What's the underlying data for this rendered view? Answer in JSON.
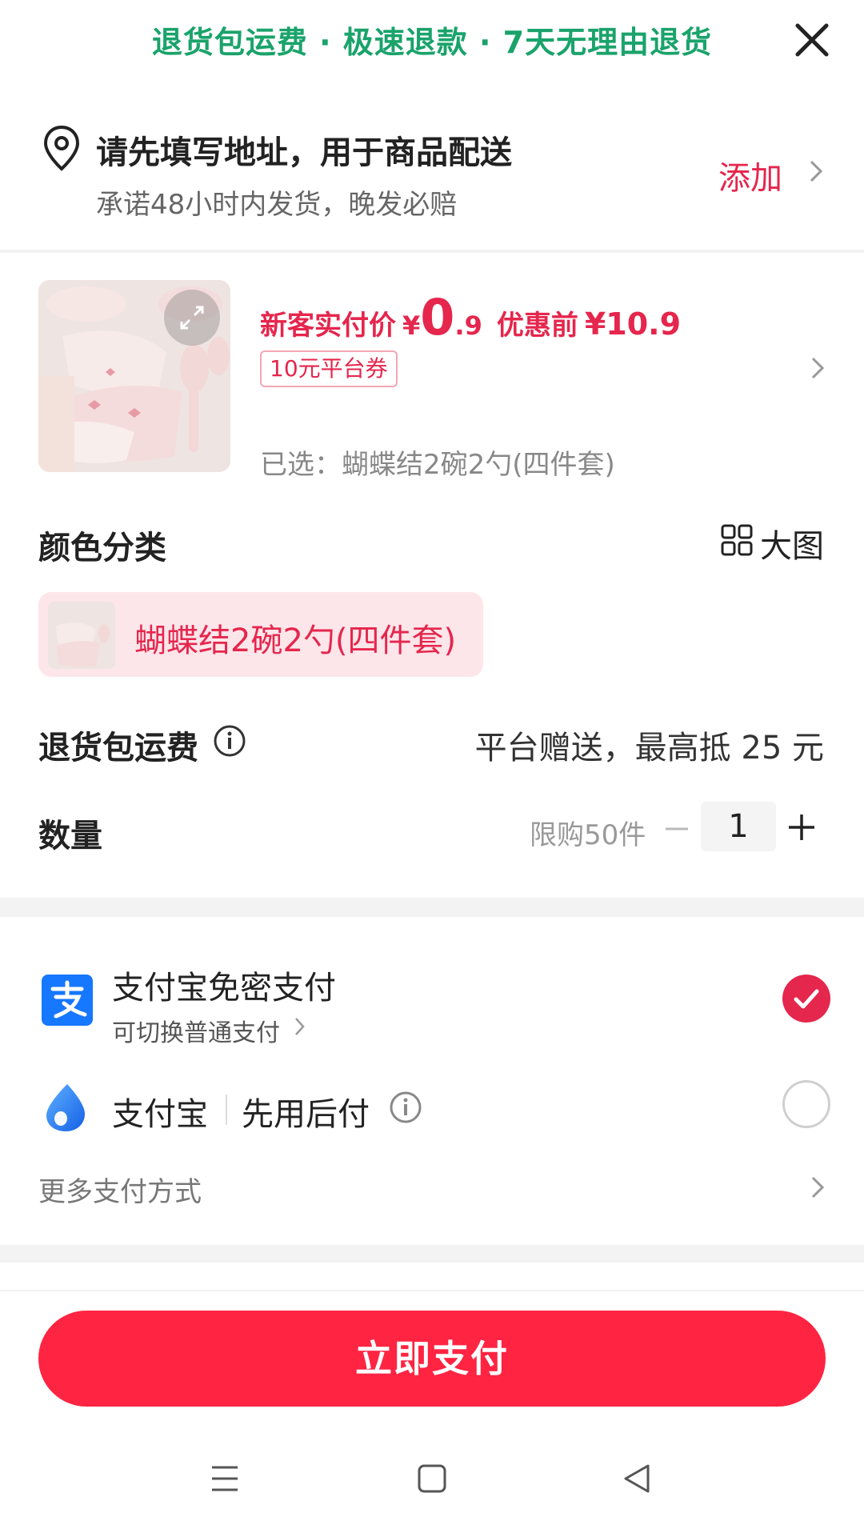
{
  "banner": {
    "text": "退货包运费 · 极速退款 · 7天无理由退货"
  },
  "address": {
    "title": "请先填写地址，用于商品配送",
    "subtitle": "承诺48小时内发货，晚发必赔",
    "add_label": "添加"
  },
  "product": {
    "price_label": "新客实付价",
    "currency": "¥",
    "price_int": "0",
    "price_dec": ".9",
    "original_label": "优惠前",
    "original_price": "¥10.9",
    "coupon": "10元平台券",
    "selected": "已选：蝴蝶结2碗2勺(四件套)"
  },
  "color_section": {
    "title": "颜色分类",
    "big_pic_label": "大图",
    "variant_label": "蝴蝶结2碗2勺(四件套)"
  },
  "return_shipping": {
    "title": "退货包运费",
    "value": "平台赠送，最高抵 25 元"
  },
  "quantity": {
    "title": "数量",
    "limit": "限购50件",
    "value": "1"
  },
  "payment": {
    "option1_title": "支付宝免密支付",
    "option1_sub": "可切换普通支付",
    "option2_title": "支付宝",
    "option2_sub": "先用后付",
    "more": "更多支付方式",
    "selected": "option1"
  },
  "pay_button": {
    "label": "立即支付"
  },
  "colors": {
    "accent": "#e5264d",
    "pay_button": "#ff2442",
    "banner_green": "#1aa36b",
    "alipay_blue": "#1677ff",
    "chip_bg": "#fde6ea"
  }
}
